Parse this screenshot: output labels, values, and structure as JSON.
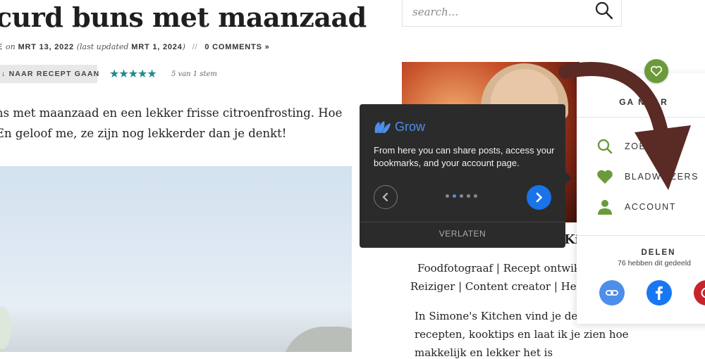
{
  "article": {
    "title": "curd buns met maanzaad",
    "meta_prefix": "E",
    "meta_on": "on",
    "date": "MRT 13, 2022",
    "updated_label": "(last updated",
    "updated_date": "MRT 1, 2024",
    "updated_close": ")",
    "separator": "//",
    "comments": "0 COMMENTS »",
    "recipe_button": "↓ NAAR RECEPT GAAN",
    "stars": "★★★★★",
    "votes": "5 van 1 stem",
    "intro_line1": "ns met maanzaad en een lekker frisse citroenfrosting. Hoe",
    "intro_line2": "En geloof me, ze zijn nog lekkerder dan je denkt!"
  },
  "sidebar": {
    "search_placeholder": "search...",
    "kitchen_name_fragment": "Kit",
    "bio_line1": "Foodfotograaf  | Recept ontwikke",
    "bio_line2": "Reiziger | Content creator | Health",
    "bio_line3": "In Simone's Kitchen vind je de lek",
    "bio_line4": "recepten, kooktips en laat ik je zien hoe",
    "bio_line5": "makkelijk en lekker het is"
  },
  "grow_popup": {
    "brand": "Grow",
    "message": "From here you can share posts, access your bookmarks, and your account page.",
    "dots": 5,
    "active_dot": 2,
    "leave_label": "VERLATEN"
  },
  "panel": {
    "heading": "GA NAAR",
    "items": [
      {
        "label": "ZOEKEN"
      },
      {
        "label": "BLADWIJZERS"
      },
      {
        "label": "ACCOUNT"
      }
    ],
    "share_title": "DELEN",
    "share_count": "76 hebben dit gedeeld"
  },
  "colors": {
    "accent_green": "#6c9a3a",
    "grow_blue": "#1a73e8",
    "facebook_blue": "#1877f2",
    "link_blue": "#4d8eea",
    "arrow_brown": "#5a2a24",
    "star_teal": "#1f8a8a"
  }
}
